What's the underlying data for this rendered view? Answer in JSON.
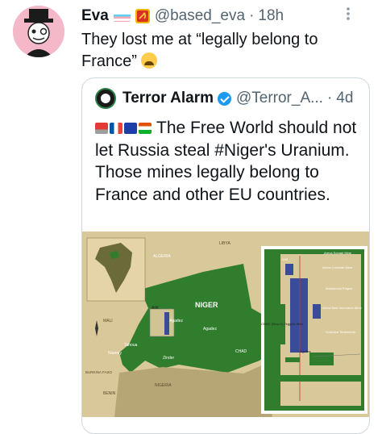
{
  "tweet": {
    "author_name": "Eva",
    "handle": "@based_eva",
    "separator": "·",
    "time": "18h",
    "text": "They lost me at “legally belong to France”",
    "more_icon": "more-horizontal-icon"
  },
  "quote": {
    "author_name": "Terror Alarm",
    "handle": "@Terror_A...",
    "separator": "·",
    "time": "4d",
    "text": "The Free World should not let Russia steal #Niger's Uranium. Those mines legally belong to France and other EU countries."
  },
  "map": {
    "labels": {
      "libya": "LIBYA",
      "algeria": "ALGERIA",
      "niger": "NIGER",
      "mali": "MALI",
      "agadez": "Agadez",
      "arlit": "Arlit",
      "tahoua": "Tahoua",
      "niamey": "Niamey",
      "zinder": "Zinder",
      "chad": "CHAD",
      "nigeria": "NIGERIA",
      "benin": "BENIN",
      "burkina": "BURKINA FASO",
      "areva_somair": "Areva Somair Mine",
      "areva_cominak": "Areva Cominak Mine",
      "madaouela": "Madaouela Project",
      "areva_new": "Areva New Imouraren Mine",
      "southern": "Southern Tenements",
      "cnnc": "CNNC (Sino-U) Teggida Mine",
      "agadez_inset": "Agadez",
      "arlit_inset": "Arlit"
    }
  },
  "colors": {
    "accent_blue": "#1d9bf0",
    "map_green": "#2f7d2d",
    "map_sand": "#d8c79a",
    "map_blue": "#3a4b9a"
  }
}
